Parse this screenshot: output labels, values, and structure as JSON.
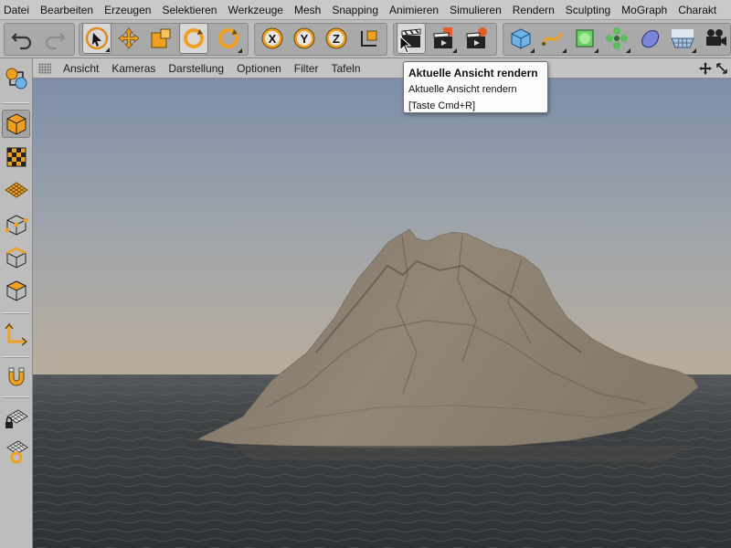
{
  "menu": [
    "Datei",
    "Bearbeiten",
    "Erzeugen",
    "Selektieren",
    "Werkzeuge",
    "Mesh",
    "Snapping",
    "Animieren",
    "Simulieren",
    "Rendern",
    "Sculpting",
    "MoGraph",
    "Charakt"
  ],
  "toolbar": {
    "undo_icon": "undo-icon",
    "redo_icon": "redo-icon",
    "axis_x": "X",
    "axis_y": "Y",
    "axis_z": "Z",
    "accent_color": "#f0a020"
  },
  "viewport_menu": [
    "Ansicht",
    "Kameras",
    "Darstellung",
    "Optionen",
    "Filter",
    "Tafeln"
  ],
  "tooltip": {
    "title": "Aktuelle Ansicht rendern",
    "description": "Aktuelle Ansicht rendern",
    "shortcut": "[Taste Cmd+R]"
  },
  "scene": {
    "sky_top": "#7f8fa8",
    "sky_horizon": "#b4ab9e",
    "sea": "#3f4244",
    "mountain": "#8a7f70"
  }
}
